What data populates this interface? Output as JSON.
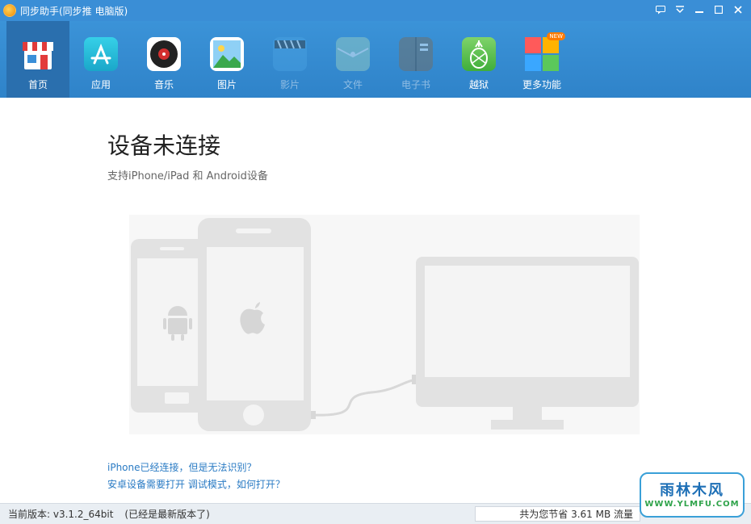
{
  "window": {
    "title": "同步助手(同步推 电脑版)"
  },
  "toolbar": {
    "items": [
      {
        "label": "首页",
        "icon": "store-icon",
        "active": true
      },
      {
        "label": "应用",
        "icon": "app-store-icon"
      },
      {
        "label": "音乐",
        "icon": "vinyl-record-icon"
      },
      {
        "label": "图片",
        "icon": "picture-icon"
      },
      {
        "label": "影片",
        "icon": "clapperboard-icon",
        "disabled": true
      },
      {
        "label": "文件",
        "icon": "folder-icon",
        "disabled": true
      },
      {
        "label": "电子书",
        "icon": "book-icon",
        "disabled": true
      },
      {
        "label": "越狱",
        "icon": "pineapple-icon"
      },
      {
        "label": "更多功能",
        "icon": "grid-icon",
        "badge": "NEW"
      }
    ]
  },
  "main": {
    "title": "设备未连接",
    "subtitle": "支持iPhone/iPad 和 Android设备",
    "links": [
      "iPhone已经连接，但是无法识别？",
      "安卓设备需要打开 调试模式，如何打开？"
    ]
  },
  "status": {
    "version": "当前版本: v3.1.2_64bit",
    "latest": "(已经是最新版本了)",
    "saved": "共为您节省  3.61 MB 流量"
  },
  "watermark": {
    "line1": "雨林木风",
    "line2": "WWW.YLMFU.COM"
  },
  "colors": {
    "accent": "#3a8ed6",
    "link": "#2a7bc4",
    "illustration": "#e4e4e4"
  }
}
